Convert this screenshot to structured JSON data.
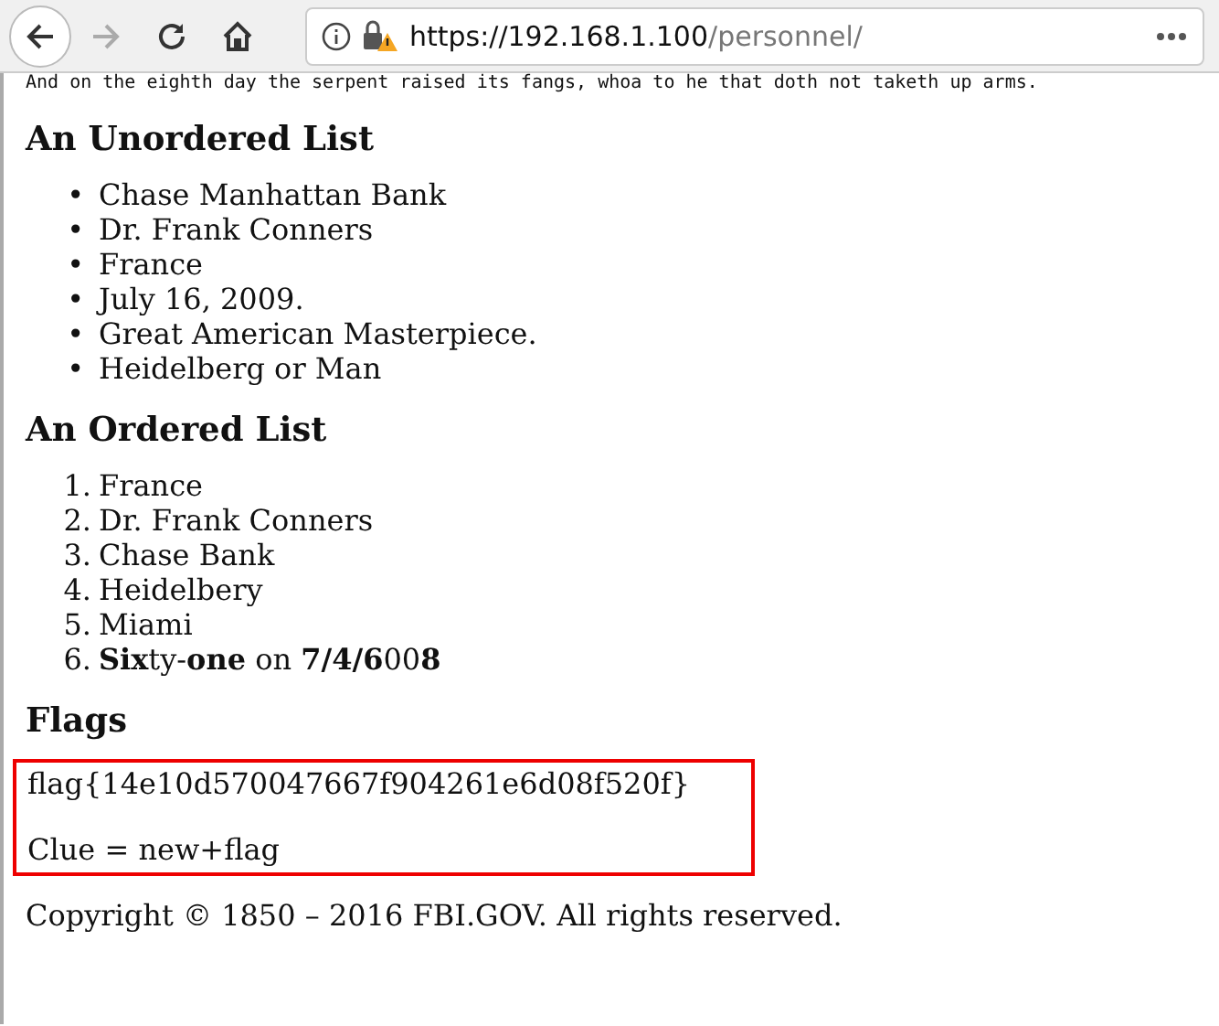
{
  "toolbar": {
    "url_host": "https://192.168.1.100",
    "url_path": "/personnel/",
    "back_disabled": false,
    "forward_disabled": true
  },
  "page": {
    "top_line": "And on the eighth day the serpent raised its fangs, whoa to he that doth not taketh up arms.",
    "unordered_heading": "An Unordered List",
    "unordered_items": [
      {
        "marker": "•",
        "text": "Chase Manhattan Bank"
      },
      {
        "marker": "•",
        "text": "Dr. Frank Conners"
      },
      {
        "marker": "•",
        "text": "France"
      },
      {
        "marker": "•",
        "text": "July 16, 2009."
      },
      {
        "marker": "•",
        "text": "Great American Masterpiece."
      },
      {
        "marker": "•",
        "text": "Heidelberg or Man"
      }
    ],
    "ordered_heading": "An Ordered List",
    "ordered_items": [
      {
        "marker": "1.",
        "text": "France"
      },
      {
        "marker": "2.",
        "text": "Dr. Frank Conners"
      },
      {
        "marker": "3.",
        "text": "Chase Bank"
      },
      {
        "marker": "4.",
        "text": "Heidelbery"
      },
      {
        "marker": "5.",
        "text": "Miami"
      },
      {
        "marker": "6.",
        "text": "**Six**ty-**one** on **7/4/6**00**8**"
      }
    ],
    "flags_heading": "Flags",
    "flag": "flag{14e10d570047667f904261e6d08f520f}",
    "clue": "Clue = new+flag",
    "copyright": "Copyright © 1850 – 2016 FBI.GOV. All rights reserved."
  }
}
